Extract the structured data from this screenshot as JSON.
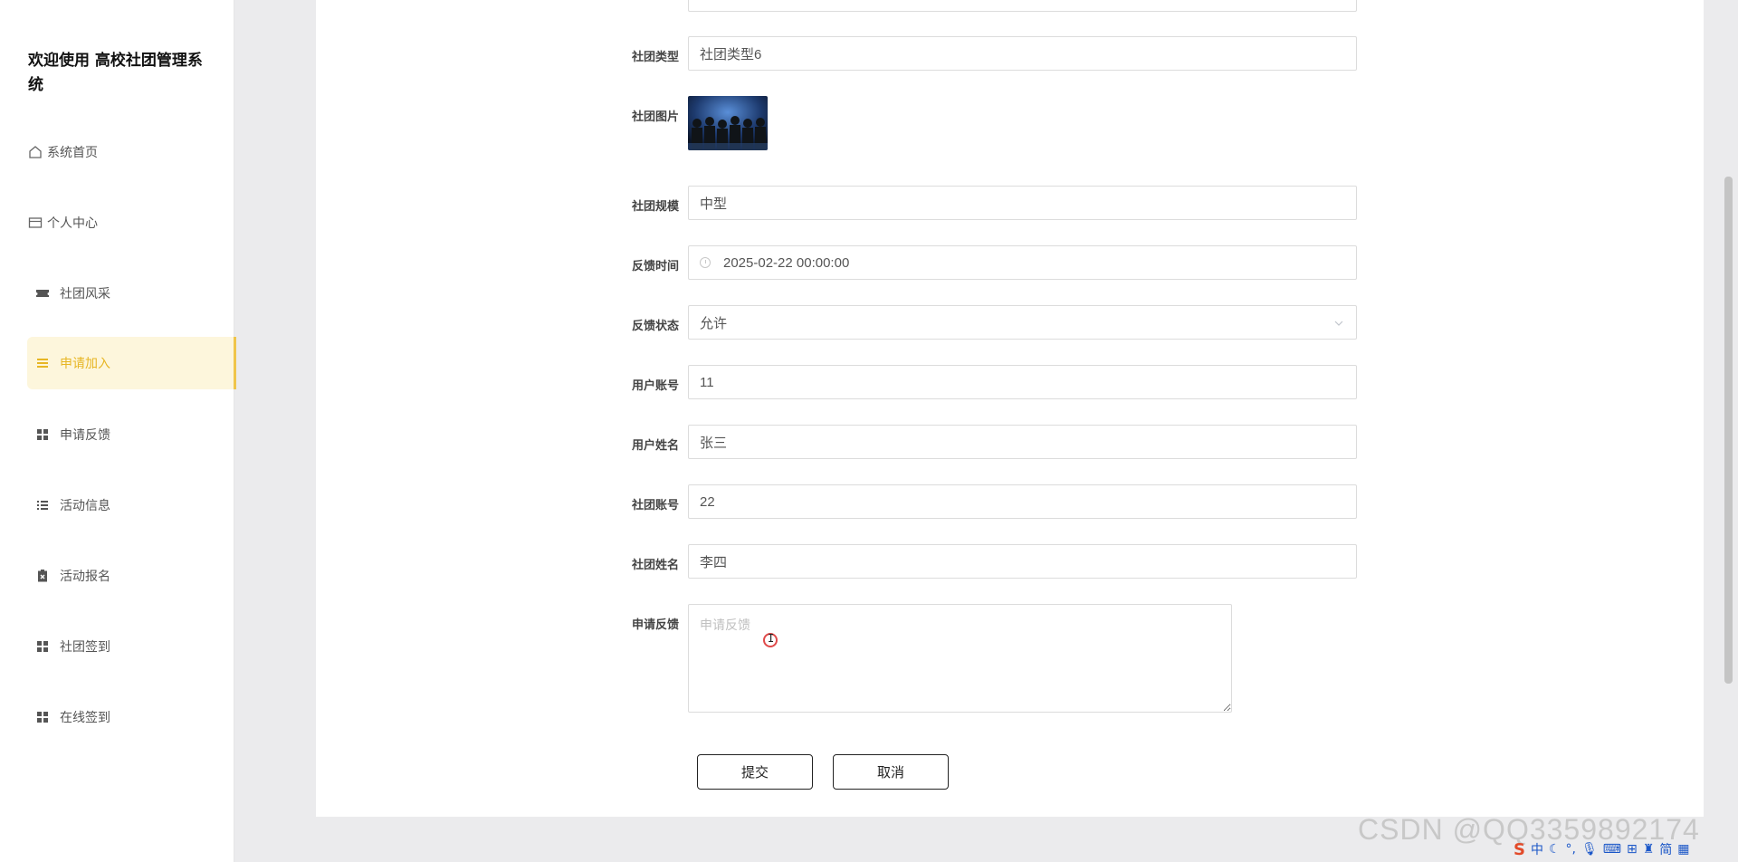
{
  "app": {
    "title": "欢迎使用 高校社团管理系统"
  },
  "sidebar": {
    "items": [
      {
        "label": "系统首页",
        "icon": "home-icon"
      },
      {
        "label": "个人中心",
        "icon": "card-icon"
      },
      {
        "label": "社团风采",
        "icon": "ticket-icon"
      },
      {
        "label": "申请加入",
        "icon": "menu-lines-icon",
        "active": true
      },
      {
        "label": "申请反馈",
        "icon": "grid-icon"
      },
      {
        "label": "活动信息",
        "icon": "list-icon"
      },
      {
        "label": "活动报名",
        "icon": "clipboard-icon"
      },
      {
        "label": "社团签到",
        "icon": "grid-icon"
      },
      {
        "label": "在线签到",
        "icon": "grid-icon"
      }
    ]
  },
  "form": {
    "top_partial_value": "",
    "club_type": {
      "label": "社团类型",
      "value": "社团类型6"
    },
    "club_image": {
      "label": "社团图片"
    },
    "club_size": {
      "label": "社团规模",
      "value": "中型"
    },
    "feedback_time": {
      "label": "反馈时间",
      "value": "2025-02-22 00:00:00"
    },
    "feedback_status": {
      "label": "反馈状态",
      "value": "允许"
    },
    "user_account": {
      "label": "用户账号",
      "value": "11"
    },
    "user_name": {
      "label": "用户姓名",
      "value": "张三"
    },
    "club_account": {
      "label": "社团账号",
      "value": "22"
    },
    "club_name": {
      "label": "社团姓名",
      "value": "李四"
    },
    "apply_feedback": {
      "label": "申请反馈",
      "placeholder": "申请反馈"
    },
    "submit_label": "提交",
    "cancel_label": "取消"
  },
  "watermark": "CSDN @QQ3359892174",
  "tray": {
    "ime_mode": "中",
    "simplified": "简"
  },
  "colors": {
    "accent": "#e7b625",
    "active_bg": "#fdf6dc"
  }
}
